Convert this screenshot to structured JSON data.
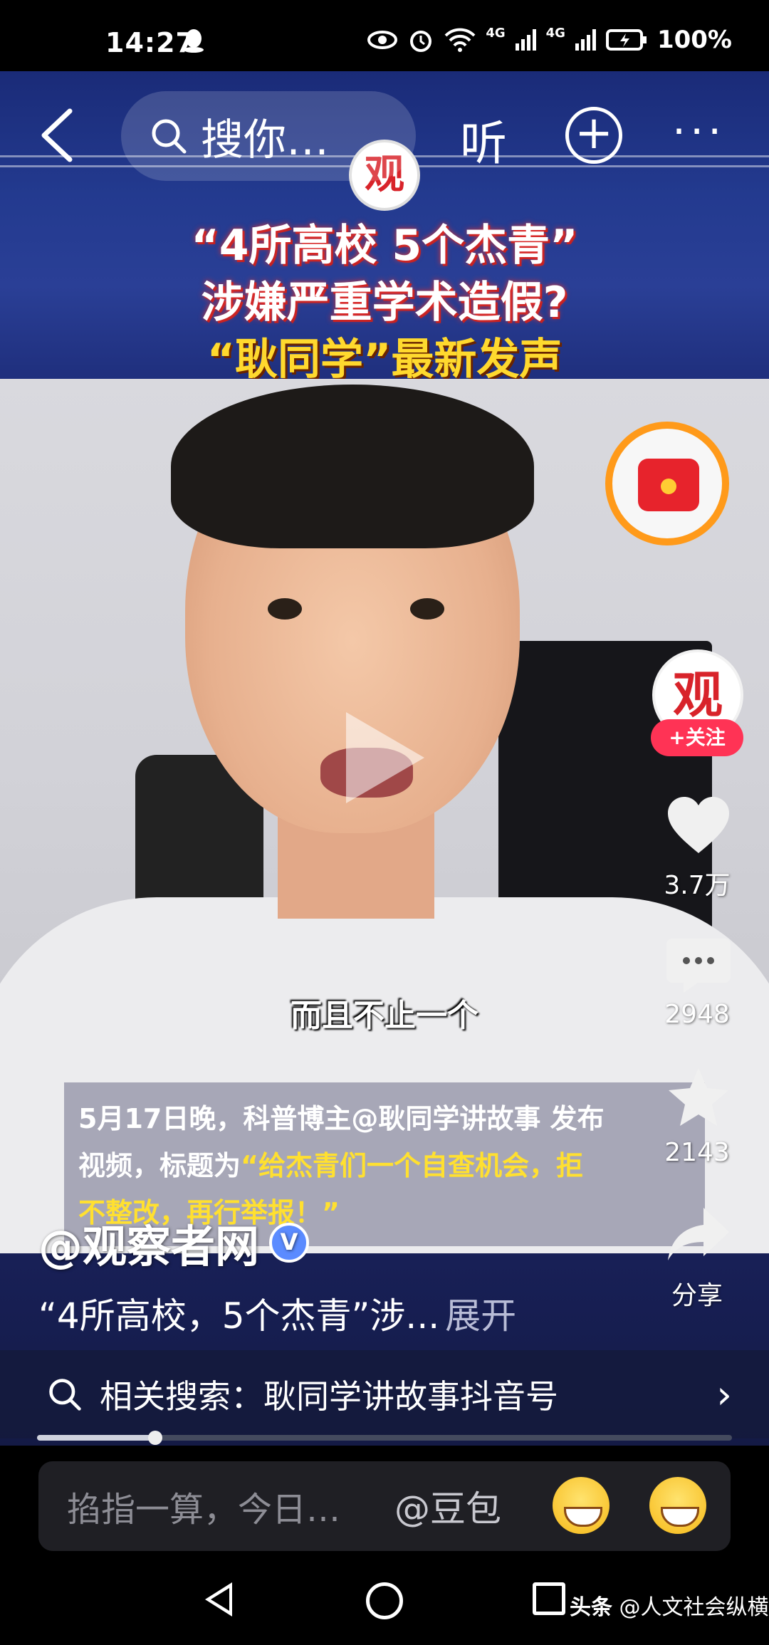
{
  "status_bar": {
    "time": "14:27",
    "network_1": "4G",
    "network_2": "4G",
    "battery": "100%"
  },
  "top_bar": {
    "search_text": "搜你…",
    "listen_label": "听",
    "add_icon": "plus-circle-icon",
    "more_icon": "more-dots-icon"
  },
  "video": {
    "headline_1": "“4所高校 5个杰青”",
    "headline_2": "涉嫌严重学术造假?",
    "headline_3": "“耿同学”最新发声",
    "badge": "观",
    "subtitle": "而且不止一个",
    "caption_plain_1": "5月17日晚，科普博主@耿同学讲故事 发布",
    "caption_plain_2": "视频，标题为",
    "caption_highlight_1": "“给杰青们一个自查机会，拒",
    "caption_highlight_2": "不整改，再行举报！”"
  },
  "right_rail": {
    "avatar_text": "观",
    "follow_label": "+关注",
    "likes": "3.7万",
    "comments": "2948",
    "favorites": "2143",
    "share_label": "分享"
  },
  "post": {
    "account": "@观察者网",
    "verified_mark": "V",
    "description": "“4所高校，5个杰青”涉...",
    "expand_label": "展开"
  },
  "related_search": {
    "text": "相关搜索：耿同学讲故事抖音号"
  },
  "progress": {
    "fraction": 0.17
  },
  "input_bar": {
    "placeholder": "掐指一算，今日…",
    "mention": "@豆包"
  },
  "watermark": {
    "brand": "头条",
    "author": "@人文社会纵横"
  }
}
